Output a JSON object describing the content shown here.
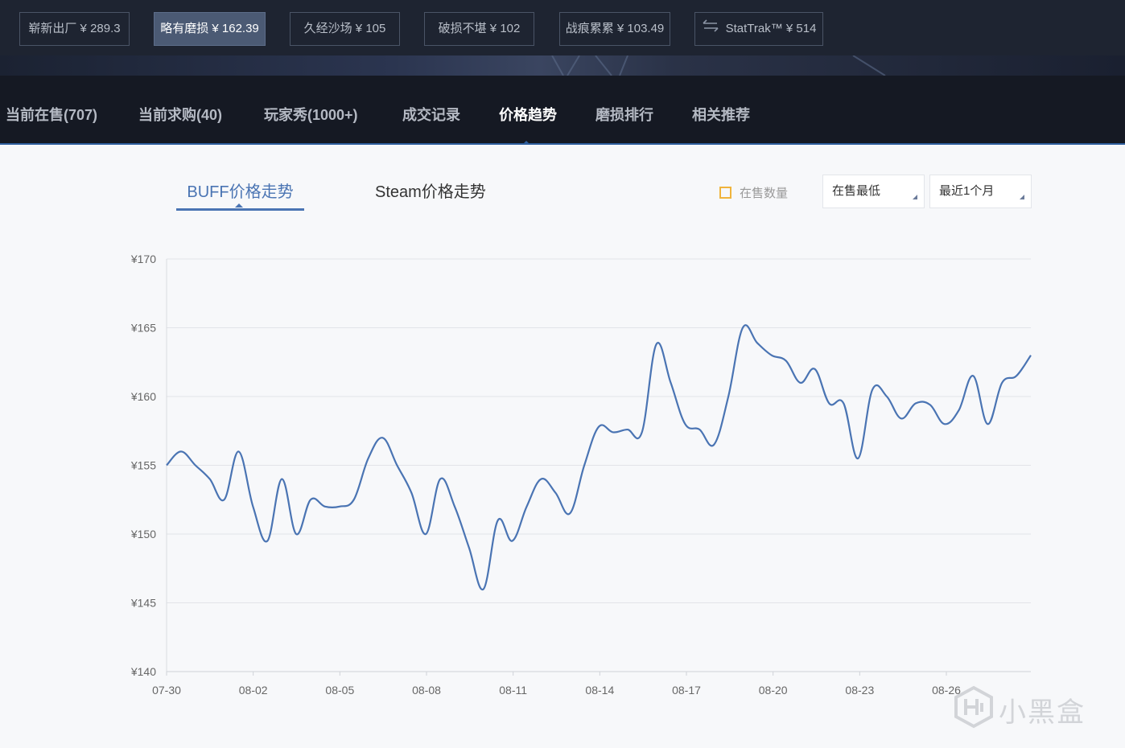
{
  "wear_options": [
    {
      "label": "崭新出厂 ¥ 289.3",
      "active": false
    },
    {
      "label": "略有磨损 ¥ 162.39",
      "active": true
    },
    {
      "label": "久经沙场 ¥ 105",
      "active": false
    },
    {
      "label": "破损不堪 ¥ 102",
      "active": false
    },
    {
      "label": "战痕累累 ¥ 103.49",
      "active": false
    }
  ],
  "stattrak": {
    "label": "StatTrak™ ¥ 514",
    "icon": "swap-arrows-icon"
  },
  "tabs": [
    {
      "label": "当前在售(707)",
      "active": false
    },
    {
      "label": "当前求购(40)",
      "active": false
    },
    {
      "label": "玩家秀(1000+)",
      "active": false
    },
    {
      "label": "成交记录",
      "active": false
    },
    {
      "label": "价格趋势",
      "active": true
    },
    {
      "label": "磨损排行",
      "active": false
    },
    {
      "label": "相关推荐",
      "active": false
    }
  ],
  "chart_tabs": {
    "buff": "BUFF价格走势",
    "steam": "Steam价格走势"
  },
  "legend": {
    "label": "在售数量",
    "color": "#f0b43c",
    "checked": false
  },
  "selects": {
    "price_type": "在售最低",
    "period": "最近1个月"
  },
  "colors": {
    "line": "#4a74b3",
    "accent": "#2f5f9e"
  },
  "chart_data": {
    "type": "line",
    "title": "",
    "xlabel": "",
    "ylabel": "",
    "ylim": [
      140,
      170
    ],
    "y_ticks": [
      "¥140",
      "¥145",
      "¥150",
      "¥155",
      "¥160",
      "¥165",
      "¥170"
    ],
    "x_ticks": [
      "07-30",
      "08-02",
      "08-05",
      "08-08",
      "08-11",
      "08-14",
      "08-17",
      "08-20",
      "08-23",
      "08-26"
    ],
    "grid": true,
    "x": [
      "07-30",
      "07-30",
      "07-31",
      "07-31",
      "08-01",
      "08-01",
      "08-02",
      "08-02",
      "08-03",
      "08-03",
      "08-04",
      "08-04",
      "08-05",
      "08-05",
      "08-06",
      "08-06",
      "08-07",
      "08-07",
      "08-08",
      "08-08",
      "08-09",
      "08-09",
      "08-10",
      "08-10",
      "08-11",
      "08-11",
      "08-12",
      "08-12",
      "08-13",
      "08-13",
      "08-14",
      "08-14",
      "08-15",
      "08-15",
      "08-16",
      "08-16",
      "08-17",
      "08-17",
      "08-18",
      "08-18",
      "08-19",
      "08-19",
      "08-20",
      "08-20",
      "08-21",
      "08-21",
      "08-22",
      "08-22",
      "08-23",
      "08-23",
      "08-24",
      "08-24",
      "08-25",
      "08-25",
      "08-26",
      "08-26",
      "08-27",
      "08-27",
      "08-28",
      "08-28"
    ],
    "values": [
      155.0,
      156.0,
      155.0,
      154.0,
      152.5,
      156.0,
      152.0,
      149.5,
      154.0,
      150.0,
      152.5,
      152.0,
      152.0,
      152.5,
      155.5,
      157.0,
      155.0,
      153.0,
      150.0,
      154.0,
      152.0,
      149.0,
      146.0,
      151.0,
      149.5,
      152.0,
      154.0,
      153.0,
      151.5,
      155.0,
      157.8,
      157.4,
      157.6,
      157.4,
      163.8,
      161.0,
      158.0,
      157.6,
      156.5,
      160.0,
      165.0,
      163.9,
      163.0,
      162.6,
      161.0,
      162.0,
      159.5,
      159.5,
      155.5,
      160.5,
      160.0,
      158.4,
      159.5,
      159.4,
      158.0,
      159.0,
      161.5,
      158.0,
      161.0,
      161.5,
      163.0
    ],
    "series": [
      {
        "values_ref": "values"
      }
    ]
  },
  "watermark": {
    "text": "小黑盒"
  }
}
